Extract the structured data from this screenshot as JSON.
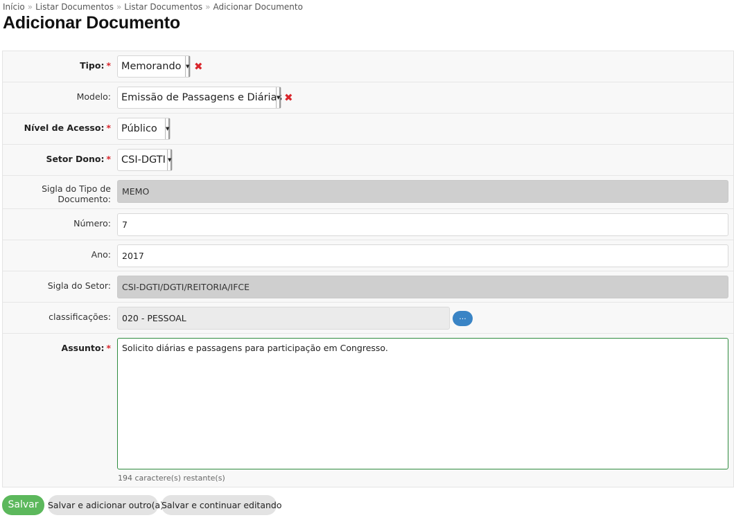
{
  "breadcrumb": {
    "items": [
      "Início",
      "Listar Documentos",
      "Listar Documentos",
      "Adicionar Documento"
    ],
    "separator": "»"
  },
  "page_title": "Adicionar Documento",
  "required_marker": "*",
  "form": {
    "tipo": {
      "label": "Tipo:",
      "value": "Memorando",
      "required": true
    },
    "modelo": {
      "label": "Modelo:",
      "value": "Emissão de Passagens e Diárias",
      "required": false
    },
    "nivel_acesso": {
      "label": "Nível de Acesso:",
      "value": "Público",
      "required": true
    },
    "setor_dono": {
      "label": "Setor Dono:",
      "value": "CSI-DGTI",
      "required": true
    },
    "sigla_tipo": {
      "label_line1": "Sigla do Tipo de",
      "label_line2": "Documento:",
      "value": "MEMO",
      "readonly": true
    },
    "numero": {
      "label": "Número:",
      "value": "7"
    },
    "ano": {
      "label": "Ano:",
      "value": "2017"
    },
    "sigla_setor": {
      "label": "Sigla do Setor:",
      "value": "CSI-DGTI/DGTI/REITORIA/IFCE",
      "readonly": true
    },
    "classificacoes": {
      "label": "classificações:",
      "value": "020 - PESSOAL",
      "button_label": "..."
    },
    "assunto": {
      "label": "Assunto:",
      "value": "Solicito diárias e passagens para participação em  Congresso.",
      "required": true,
      "helper": "194 caractere(s) restante(s)"
    }
  },
  "actions": {
    "save": "Salvar",
    "save_add_another": "Salvar e adicionar outro(a)",
    "save_continue": "Salvar e continuar editando"
  },
  "colors": {
    "required_star": "#d9262c",
    "primary_button": "#5cb85c",
    "dots_button": "#3a84c5",
    "textarea_focus_border": "#2e8b3e",
    "readonly_input": "#cfcfcf"
  }
}
